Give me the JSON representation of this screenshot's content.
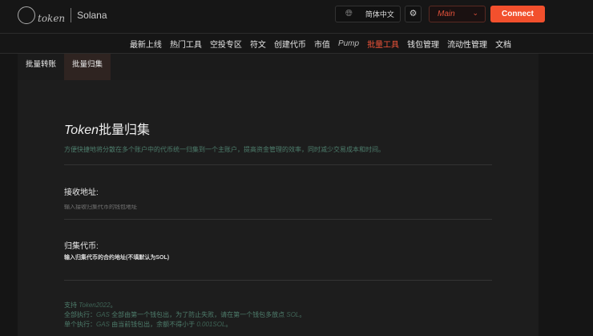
{
  "header": {
    "logo_text": "token",
    "chain": "Solana",
    "language": "简体中文",
    "network": "Main",
    "connect_label": "Connect"
  },
  "nav": [
    "最新上线",
    "热门工具",
    "空投专区",
    "符文",
    "创建代币",
    "市值",
    "Pump",
    "批量工具",
    "钱包管理",
    "流动性管理",
    "文档"
  ],
  "subnav": [
    "批量转账",
    "批量归集"
  ],
  "main": {
    "title_en": "Token",
    "title_cn": "批量归集",
    "description": "方便快捷地将分散在多个账户中的代币统一归集到一个主账户，提高资金管理的效率，同时减少交易成本和时间。",
    "receive_label": "接收地址:",
    "receive_placeholder": "输入接收归集代币的钱包地址",
    "token_label": "归集代币:",
    "token_hint": "输入归集代币的合约地址(不填默认为SOL)",
    "notes": [
      {
        "a": "支持 ",
        "b": "Token2022",
        "c": "。"
      },
      {
        "a": "全部执行：",
        "b": "GAS",
        "c": " 全部由第一个钱包出，为了防止失败，请在第一个钱包多放点 ",
        "d": "SOL",
        "e": "。"
      },
      {
        "a": "单个执行：",
        "b": "GAS",
        "c": " 由当前钱包出，余额不得小于 ",
        "d": "0.001SOL",
        "e": "。"
      }
    ]
  }
}
